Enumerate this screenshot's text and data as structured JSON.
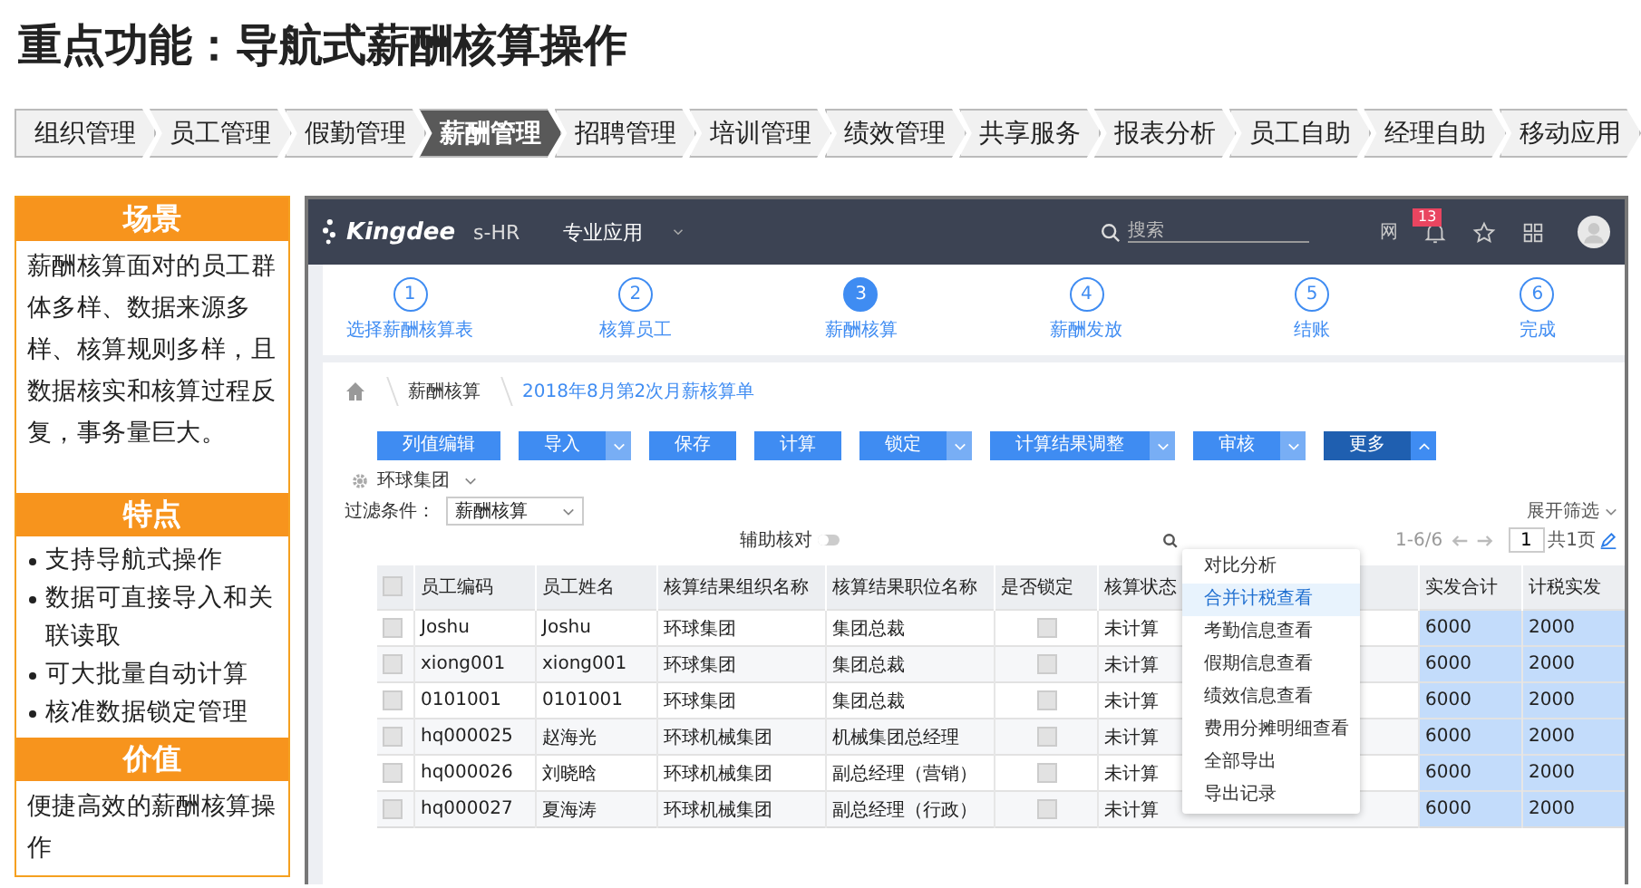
{
  "title": "重点功能：导航式薪酬核算操作",
  "modules": [
    {
      "label": "组织管理",
      "selected": false
    },
    {
      "label": "员工管理",
      "selected": false
    },
    {
      "label": "假勤管理",
      "selected": false
    },
    {
      "label": "薪酬管理",
      "selected": true
    },
    {
      "label": "招聘管理",
      "selected": false
    },
    {
      "label": "培训管理",
      "selected": false
    },
    {
      "label": "绩效管理",
      "selected": false
    },
    {
      "label": "共享服务",
      "selected": false
    },
    {
      "label": "报表分析",
      "selected": false
    },
    {
      "label": "员工自助",
      "selected": false
    },
    {
      "label": "经理自助",
      "selected": false
    },
    {
      "label": "移动应用",
      "selected": false
    }
  ],
  "panels": [
    {
      "heading": "场景",
      "kind": "paragraph",
      "text": "薪酬核算面对的员工群体多样、数据来源多样、核算规则多样，且数据核实和核算过程反复，事务量巨大。"
    },
    {
      "heading": "特点",
      "kind": "bullets",
      "items": [
        "支持导航式操作",
        "数据可直接导入和关联读取",
        "可大批量自动计算",
        "核准数据锁定管理"
      ]
    },
    {
      "heading": "价值",
      "kind": "paragraph",
      "text": "便捷高效的薪酬核算操作"
    }
  ],
  "app": {
    "logo": "Kingdee",
    "product": "s-HR",
    "menu": "专业应用",
    "search": {
      "placeholder": "搜索"
    },
    "header_link": "网",
    "notifications": "13",
    "steps": [
      {
        "number": "1",
        "label": "选择薪酬核算表",
        "selected": false
      },
      {
        "number": "2",
        "label": "核算员工",
        "selected": false
      },
      {
        "number": "3",
        "label": "薪酬核算",
        "selected": true
      },
      {
        "number": "4",
        "label": "薪酬发放",
        "selected": false
      },
      {
        "number": "5",
        "label": "结账",
        "selected": false
      },
      {
        "number": "6",
        "label": "完成",
        "selected": false
      }
    ],
    "breadcrumb": [
      "薪酬核算",
      "2018年8月第2次月薪核算单"
    ],
    "toolbar": [
      {
        "label": "列值编辑",
        "dropdown": false,
        "selected": false
      },
      {
        "label": "导入",
        "dropdown": true,
        "selected": false
      },
      {
        "label": "保存",
        "dropdown": false,
        "selected": false
      },
      {
        "label": "计算",
        "dropdown": false,
        "selected": false
      },
      {
        "label": "锁定",
        "dropdown": true,
        "selected": false
      },
      {
        "label": "计算结果调整",
        "dropdown": true,
        "selected": false
      },
      {
        "label": "审核",
        "dropdown": true,
        "selected": false
      },
      {
        "label": "更多",
        "dropdown": true,
        "selected": true
      }
    ],
    "org": "环球集团",
    "filter": {
      "label": "过滤条件：",
      "value": "薪酬核算"
    },
    "assist": {
      "label": "辅助核对",
      "on": false
    },
    "expand_filter": "展开筛选",
    "range": "1-6/6",
    "page": "1",
    "total_pages": "共1页",
    "more_menu": [
      {
        "label": "对比分析",
        "selected": false
      },
      {
        "label": "合并计税查看",
        "selected": true
      },
      {
        "label": "考勤信息查看",
        "selected": false
      },
      {
        "label": "假期信息查看",
        "selected": false
      },
      {
        "label": "绩效信息查看",
        "selected": false
      },
      {
        "label": "费用分摊明细查看",
        "selected": false
      },
      {
        "label": "全部导出",
        "selected": false
      },
      {
        "label": "导出记录",
        "selected": false
      }
    ],
    "select_all": false,
    "columns": [
      {
        "label": "员工编码",
        "kind": "text"
      },
      {
        "label": "员工姓名",
        "kind": "text"
      },
      {
        "label": "核算结果组织名称",
        "kind": "text"
      },
      {
        "label": "核算结果职位名称",
        "kind": "text"
      },
      {
        "label": "是否锁定",
        "kind": "check"
      },
      {
        "label": "核算状态",
        "kind": "text"
      },
      {
        "label": "实发合计",
        "kind": "amount"
      },
      {
        "label": "计税实发",
        "kind": "amount"
      }
    ],
    "rows": [
      {
        "checked": false,
        "code": "Joshu",
        "name": "Joshu",
        "org": "环球集团",
        "position": "集团总裁",
        "locked": false,
        "status": "未计算",
        "net": "6000",
        "taxable": "2000"
      },
      {
        "checked": false,
        "code": "xiong001",
        "name": "xiong001",
        "org": "环球集团",
        "position": "集团总裁",
        "locked": false,
        "status": "未计算",
        "net": "6000",
        "taxable": "2000"
      },
      {
        "checked": false,
        "code": "0101001",
        "name": "0101001",
        "org": "环球集团",
        "position": "集团总裁",
        "locked": false,
        "status": "未计算",
        "net": "6000",
        "taxable": "2000"
      },
      {
        "checked": false,
        "code": "hq000025",
        "name": "赵海光",
        "org": "环球机械集团",
        "position": "机械集团总经理",
        "locked": false,
        "status": "未计算",
        "net": "6000",
        "taxable": "2000"
      },
      {
        "checked": false,
        "code": "hq000026",
        "name": "刘晓晗",
        "org": "环球机械集团",
        "position": "副总经理（营销）",
        "locked": false,
        "status": "未计算",
        "net": "6000",
        "taxable": "2000"
      },
      {
        "checked": false,
        "code": "hq000027",
        "name": "夏海涛",
        "org": "环球机械集团",
        "position": "副总经理（行政）",
        "locked": false,
        "status": "未计算",
        "net": "6000",
        "taxable": "2000"
      }
    ]
  }
}
